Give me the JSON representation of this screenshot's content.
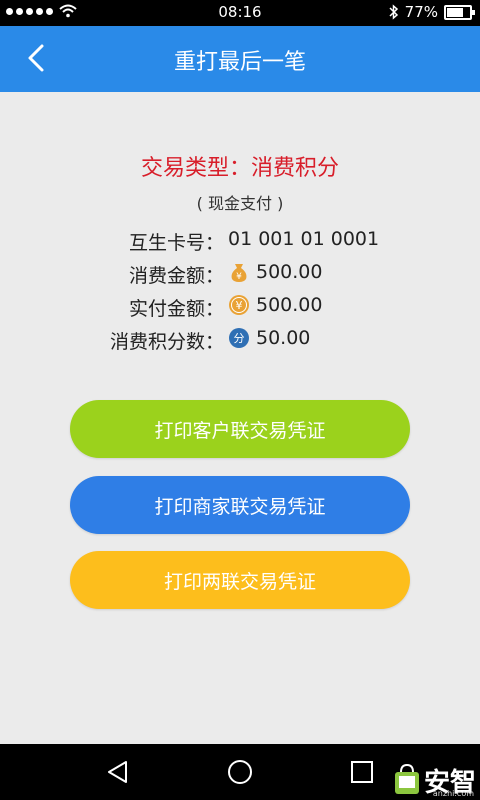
{
  "status_bar": {
    "time": "08:16",
    "battery": "77%"
  },
  "header": {
    "title": "重打最后一笔"
  },
  "transaction": {
    "type_label": "交易类型：消费积分",
    "payment_method": "( 现金支付 )"
  },
  "details": [
    {
      "label": "互生卡号：",
      "value": "01 001 01 0001",
      "icon": ""
    },
    {
      "label": "消费金额：",
      "value": "500.00",
      "icon": "money-bag-icon"
    },
    {
      "label": "实付金额：",
      "value": "500.00",
      "icon": "yuan-coin-icon"
    },
    {
      "label": "消费积分数：",
      "value": "50.00",
      "icon": "points-icon"
    }
  ],
  "icons": {
    "points_glyph": "分",
    "yuan_glyph": "¥"
  },
  "buttons": {
    "customer_receipt": "打印客户联交易凭证",
    "merchant_receipt": "打印商家联交易凭证",
    "both_receipts": "打印两联交易凭证"
  },
  "watermark": {
    "text": "安智",
    "sub": "anzhi.com"
  },
  "colors": {
    "header": "#2a8ae8",
    "type_text": "#d81e2a",
    "btn_customer": "#9bd21c",
    "btn_merchant": "#2f7ee6",
    "btn_both": "#fdbe1c",
    "icon_bag": "#e9a235",
    "icon_points": "#2f6fb4"
  }
}
